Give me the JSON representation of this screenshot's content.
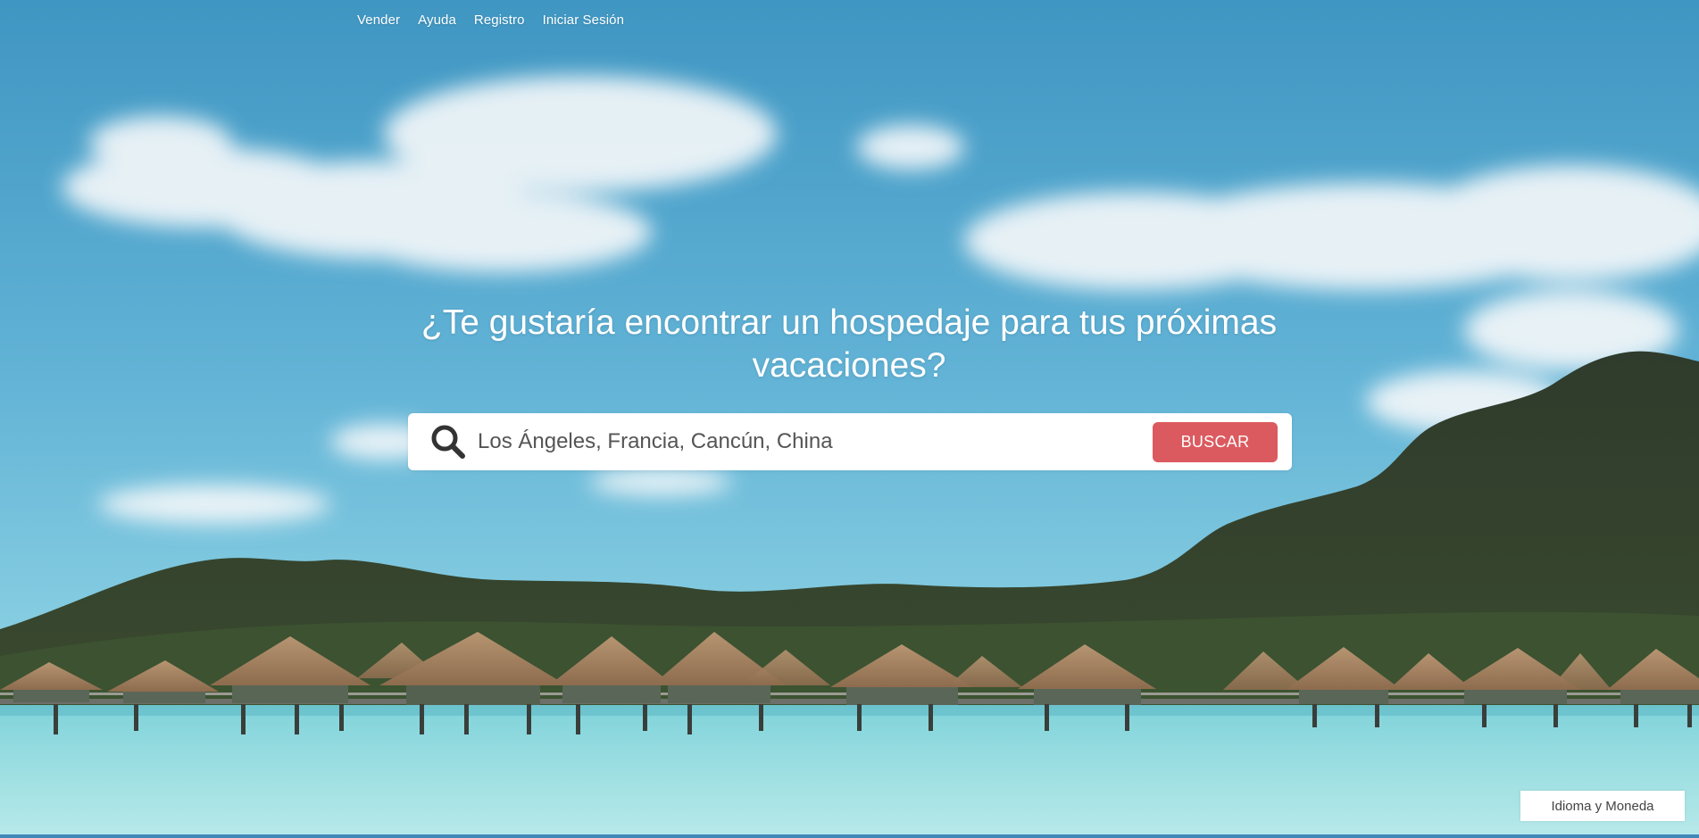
{
  "nav": {
    "items": [
      {
        "label": "Vender"
      },
      {
        "label": "Ayuda"
      },
      {
        "label": "Registro"
      },
      {
        "label": "Iniciar Sesión"
      }
    ]
  },
  "hero": {
    "title": "¿Te gustaría encontrar un hospedaje para tus próximas vacaciones?"
  },
  "search": {
    "placeholder": "Los Ángeles, Francia, Cancún, China",
    "button_label": "BUSCAR",
    "icon": "search-icon"
  },
  "footer": {
    "language_currency_label": "Idioma y Moneda"
  },
  "colors": {
    "accent": "#db5a5f",
    "sky": "#5aaed1",
    "text_light": "#ffffff"
  }
}
